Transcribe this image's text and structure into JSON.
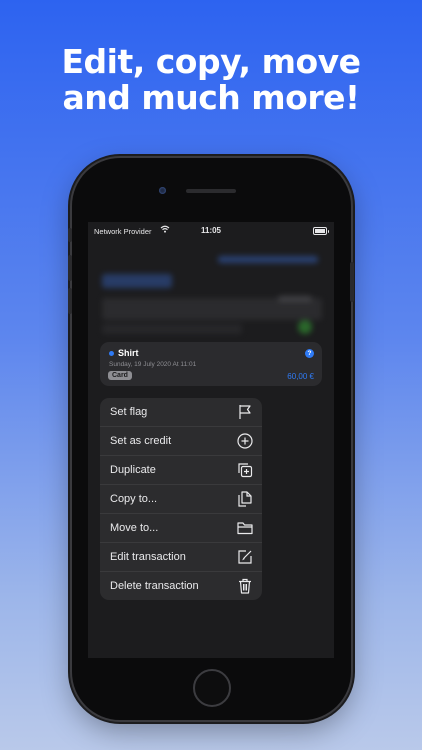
{
  "promo": {
    "headline_line1": "Edit, copy, move",
    "headline_line2": "and much more!"
  },
  "status_bar": {
    "carrier": "Network Provider",
    "time": "11:05"
  },
  "transaction": {
    "title": "Shirt",
    "date": "Sunday, 19 July 2020 At 11:01",
    "tag": "Card",
    "amount": "60,00 €",
    "info_symbol": "?"
  },
  "context_menu": {
    "items": [
      {
        "label": "Set flag",
        "icon": "flag-icon"
      },
      {
        "label": "Set as credit",
        "icon": "plus-circle-icon"
      },
      {
        "label": "Duplicate",
        "icon": "duplicate-icon"
      },
      {
        "label": "Copy to...",
        "icon": "copy-docs-icon"
      },
      {
        "label": "Move to...",
        "icon": "folder-icon"
      },
      {
        "label": "Edit transaction",
        "icon": "edit-icon"
      },
      {
        "label": "Delete transaction",
        "icon": "trash-icon"
      }
    ]
  },
  "colors": {
    "accent": "#2f7bf6",
    "menu_bg": "#2c2c2e",
    "screen_bg": "#1c1c1e"
  }
}
